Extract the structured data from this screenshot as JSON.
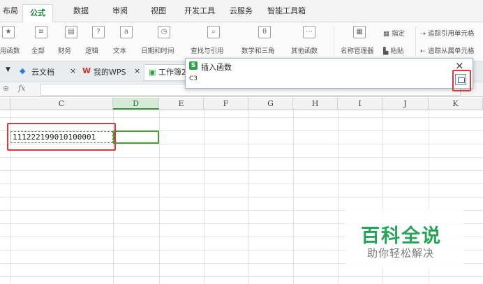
{
  "ribbon_tabs": [
    "布局",
    "公式",
    "数据",
    "审阅",
    "视图",
    "开发工具",
    "云服务",
    "智能工具箱"
  ],
  "active_tab": "公式",
  "ribbon": {
    "groups": [
      "用函数",
      "全部",
      "财务",
      "逻辑",
      "文本",
      "日期和时间",
      "查找与引用",
      "数学和三角",
      "其他函数",
      "名称管理器"
    ],
    "right_items": [
      "指定",
      "粘贴",
      "追踪引用单元格",
      "追踪从属单元格"
    ]
  },
  "doc_tabs": [
    {
      "label": "云文档",
      "close": "×"
    },
    {
      "label": "我的WPS",
      "close": "×"
    },
    {
      "label": "工作簿2"
    }
  ],
  "formula_bar": {
    "fx_label": "fx",
    "value": ""
  },
  "columns": [
    "C",
    "D",
    "E",
    "F",
    "G",
    "H",
    "I",
    "J",
    "K"
  ],
  "selected_column": "D",
  "cells": {
    "c3": "111222199010100001"
  },
  "dialog": {
    "title": "插入函数",
    "input": "C3",
    "close": "×"
  },
  "watermark": {
    "title": "百科全说",
    "subtitle": "助你轻松解决"
  },
  "colors": {
    "accent": "#2ea043",
    "highlight": "#e0363b"
  }
}
